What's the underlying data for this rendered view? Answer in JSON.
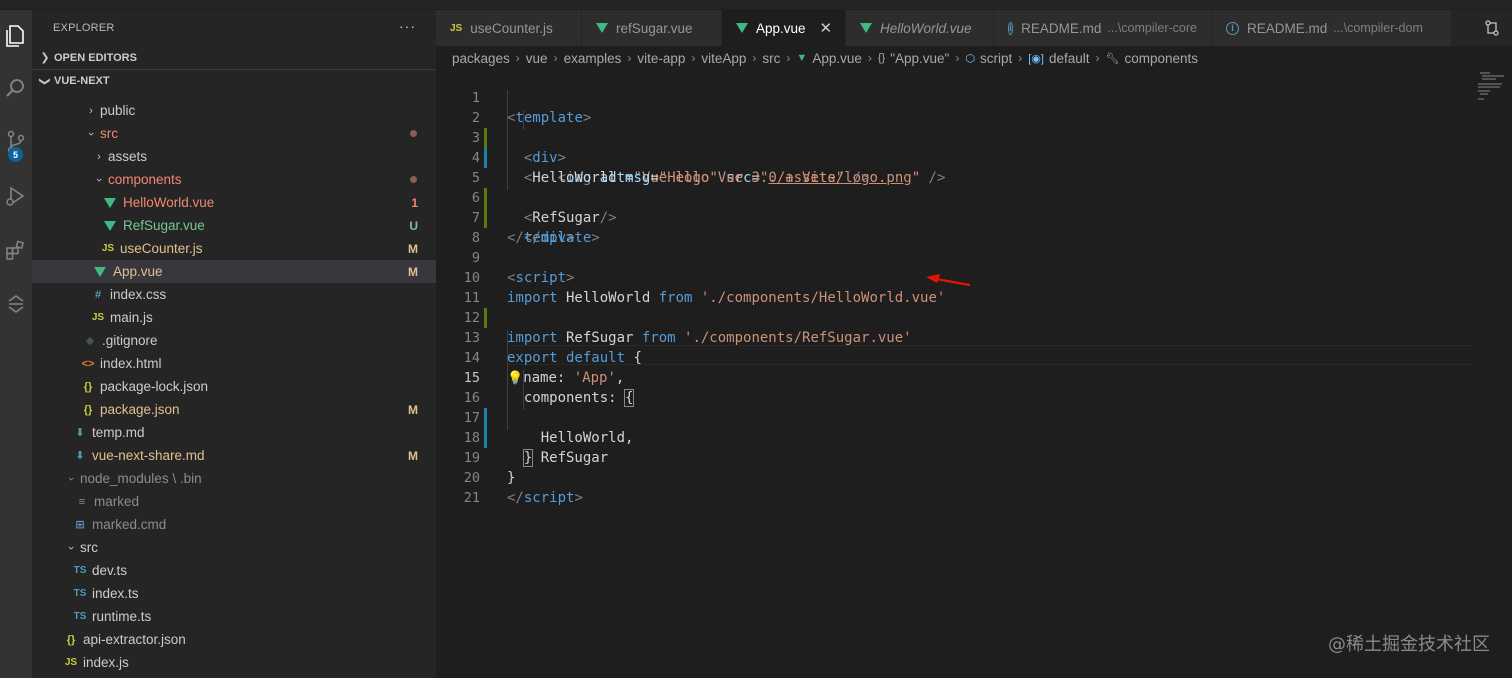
{
  "sidebar": {
    "title": "EXPLORER",
    "more": "···",
    "sections": {
      "open_editors": "OPEN EDITORS",
      "workspace": "VUE-NEXT"
    },
    "tree": [
      {
        "label": "public",
        "kind": "folder",
        "collapsed": true,
        "status": ""
      },
      {
        "label": "src",
        "kind": "folder",
        "collapsed": false,
        "status": "dot"
      },
      {
        "label": "assets",
        "kind": "folder",
        "collapsed": true,
        "status": ""
      },
      {
        "label": "components",
        "kind": "folder",
        "collapsed": false,
        "status": "dot"
      },
      {
        "label": "HelloWorld.vue",
        "kind": "vue",
        "status": "1"
      },
      {
        "label": "RefSugar.vue",
        "kind": "vue",
        "status": "U"
      },
      {
        "label": "useCounter.js",
        "kind": "js",
        "status": "M"
      },
      {
        "label": "App.vue",
        "kind": "vue",
        "status": "M"
      },
      {
        "label": "index.css",
        "kind": "css",
        "status": ""
      },
      {
        "label": "main.js",
        "kind": "js",
        "status": ""
      },
      {
        "label": ".gitignore",
        "kind": "git",
        "status": ""
      },
      {
        "label": "index.html",
        "kind": "html",
        "status": ""
      },
      {
        "label": "package-lock.json",
        "kind": "json",
        "status": ""
      },
      {
        "label": "package.json",
        "kind": "json",
        "status": "M"
      },
      {
        "label": "temp.md",
        "kind": "md",
        "status": ""
      },
      {
        "label": "vue-next-share.md",
        "kind": "md",
        "status": "M"
      },
      {
        "label": "node_modules \\ .bin",
        "kind": "folder",
        "collapsed": false,
        "status": ""
      },
      {
        "label": "marked",
        "kind": "file",
        "status": ""
      },
      {
        "label": "marked.cmd",
        "kind": "win",
        "status": ""
      },
      {
        "label": "src",
        "kind": "folder",
        "collapsed": false,
        "status": ""
      },
      {
        "label": "dev.ts",
        "kind": "ts",
        "status": ""
      },
      {
        "label": "index.ts",
        "kind": "ts",
        "status": ""
      },
      {
        "label": "runtime.ts",
        "kind": "ts",
        "status": ""
      },
      {
        "label": "api-extractor.json",
        "kind": "json",
        "status": ""
      },
      {
        "label": "index.js",
        "kind": "js",
        "status": ""
      }
    ]
  },
  "activity": {
    "scm_badge": "5"
  },
  "tabs": [
    {
      "label": "useCounter.js",
      "icon": "JS",
      "desc": "",
      "active": false
    },
    {
      "label": "refSugar.vue",
      "icon": "vue",
      "desc": "",
      "active": false
    },
    {
      "label": "App.vue",
      "icon": "vue",
      "desc": "",
      "active": true,
      "close": "✕"
    },
    {
      "label": "HelloWorld.vue",
      "icon": "vue",
      "desc": "",
      "active": false,
      "italic": true
    },
    {
      "label": "README.md",
      "icon": "info",
      "desc": "...\\compiler-core",
      "active": false
    },
    {
      "label": "README.md",
      "icon": "info",
      "desc": "...\\compiler-dom",
      "active": false
    }
  ],
  "breadcrumb": [
    "packages",
    "vue",
    "examples",
    "vite-app",
    "viteApp",
    "src",
    "App.vue",
    "\"App.vue\"",
    "script",
    "default",
    "components"
  ],
  "editor": {
    "lines": [
      "1",
      "2",
      "3",
      "4",
      "5",
      "6",
      "7",
      "8",
      "9",
      "10",
      "11",
      "12",
      "13",
      "14",
      "15",
      "16",
      "17",
      "18",
      "19",
      "20",
      "21"
    ],
    "code": {
      "l1_open": "<",
      "l1_tag": "template",
      "l1_close": ">",
      "l2_tag": "div",
      "l3_tag": "img",
      "l3_attr1": "alt",
      "l3_val1": "\"Vue logo\"",
      "l3_attr2": "src",
      "l3_val2a": "\"",
      "l3_val2b": "./assets/logo.png",
      "l3_val2c": "\"",
      "l3_end": " />",
      "l4_tag": "HelloWorld",
      "l4_attr": "msg",
      "l4_val": "\"Hello Vue 3.0 + Vite\"",
      "l4_end": " />",
      "l5_tag": "RefSugar",
      "l5_end": "/>",
      "l6_tag": "div",
      "l7_tag": "template",
      "l9_tag": "script",
      "l10_kw": "import",
      "l10_id": " HelloWorld ",
      "l10_from": "from",
      "l10_str": " './components/HelloWorld.vue'",
      "l11_kw": "import",
      "l11_id": " RefSugar ",
      "l11_from": "from",
      "l11_str": " './components/RefSugar.vue'",
      "l13_kw1": "export",
      "l13_kw2": " default",
      "l13_brace": " {",
      "l14_bulb": "💡",
      "l14_key": "name",
      "l14_colon": ": ",
      "l14_str": "'App'",
      "l14_comma": ",",
      "l15_key": "components",
      "l15_colon": ": ",
      "l15_brace": "{",
      "l16_text": "HelloWorld,",
      "l17_text": "RefSugar",
      "l18_text": "}",
      "l19_text": "}",
      "l20_tag": "script"
    }
  },
  "watermark": "@稀土掘金技术社区",
  "colors": {
    "accent": "#41b883",
    "arrow": "#e51400"
  }
}
